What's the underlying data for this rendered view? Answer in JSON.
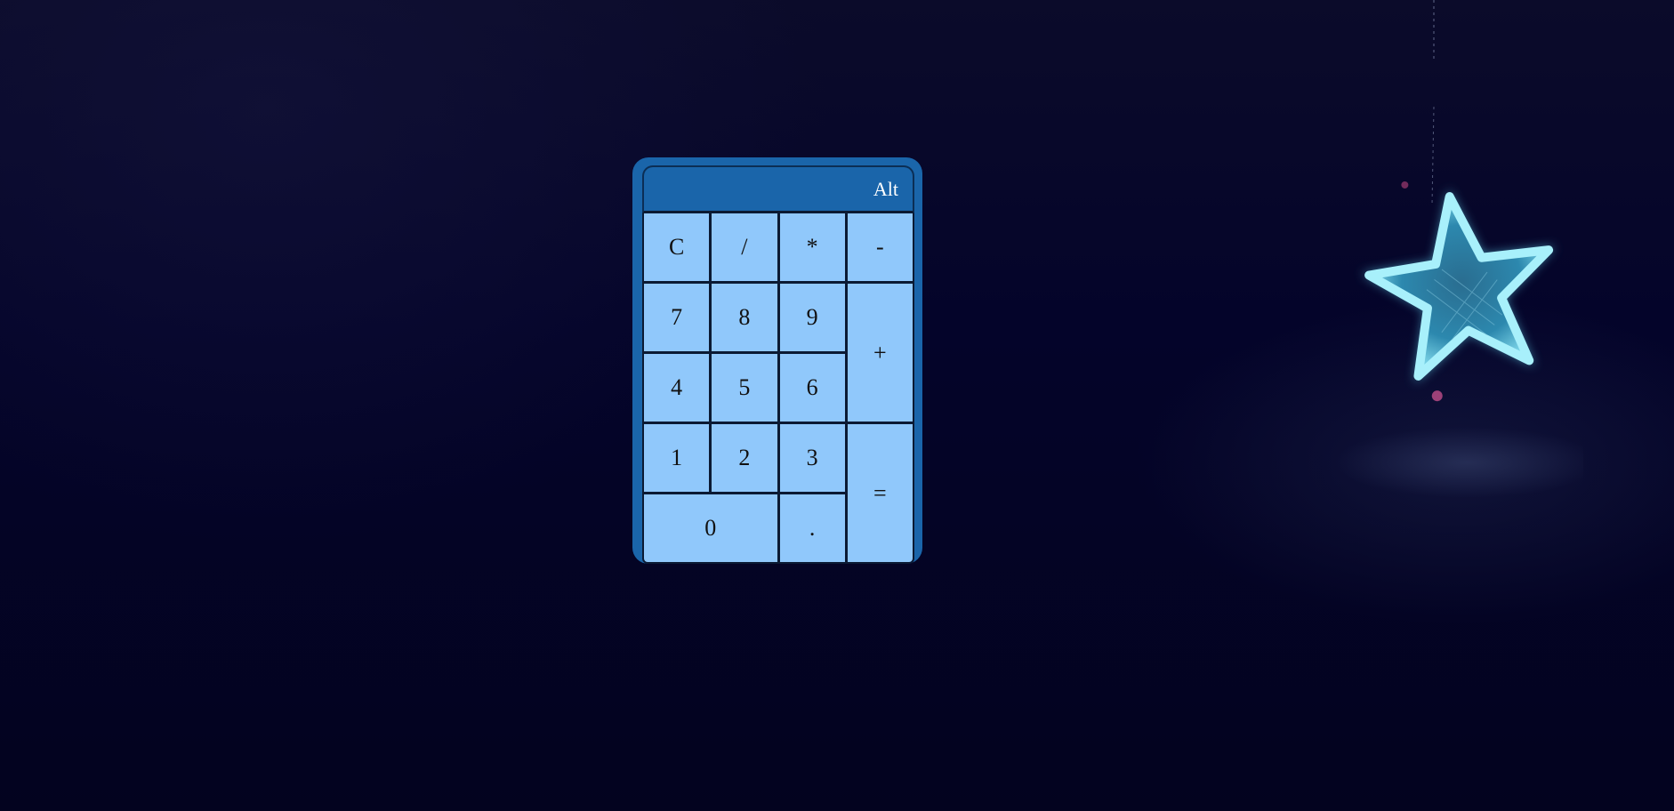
{
  "calculator": {
    "display": "Alt",
    "keys": [
      {
        "label": "C",
        "name": "key-clear"
      },
      {
        "label": "/",
        "name": "key-divide"
      },
      {
        "label": "*",
        "name": "key-multiply"
      },
      {
        "label": "-",
        "name": "key-subtract"
      },
      {
        "label": "7",
        "name": "key-7"
      },
      {
        "label": "8",
        "name": "key-8"
      },
      {
        "label": "9",
        "name": "key-9"
      },
      {
        "label": "+",
        "name": "key-add"
      },
      {
        "label": "4",
        "name": "key-4"
      },
      {
        "label": "5",
        "name": "key-5"
      },
      {
        "label": "6",
        "name": "key-6"
      },
      {
        "label": "1",
        "name": "key-1"
      },
      {
        "label": "2",
        "name": "key-2"
      },
      {
        "label": "3",
        "name": "key-3"
      },
      {
        "label": "=",
        "name": "key-equals"
      },
      {
        "label": "0",
        "name": "key-0"
      },
      {
        "label": ".",
        "name": "key-decimal"
      }
    ]
  },
  "decoration": {
    "icons": [
      "moon-icon",
      "star-icon"
    ],
    "colors": {
      "background": "#04042a",
      "calculator_frame": "#1a65aa",
      "key_face": "#90c8fb",
      "star_glow": "#6fd3ee"
    }
  }
}
